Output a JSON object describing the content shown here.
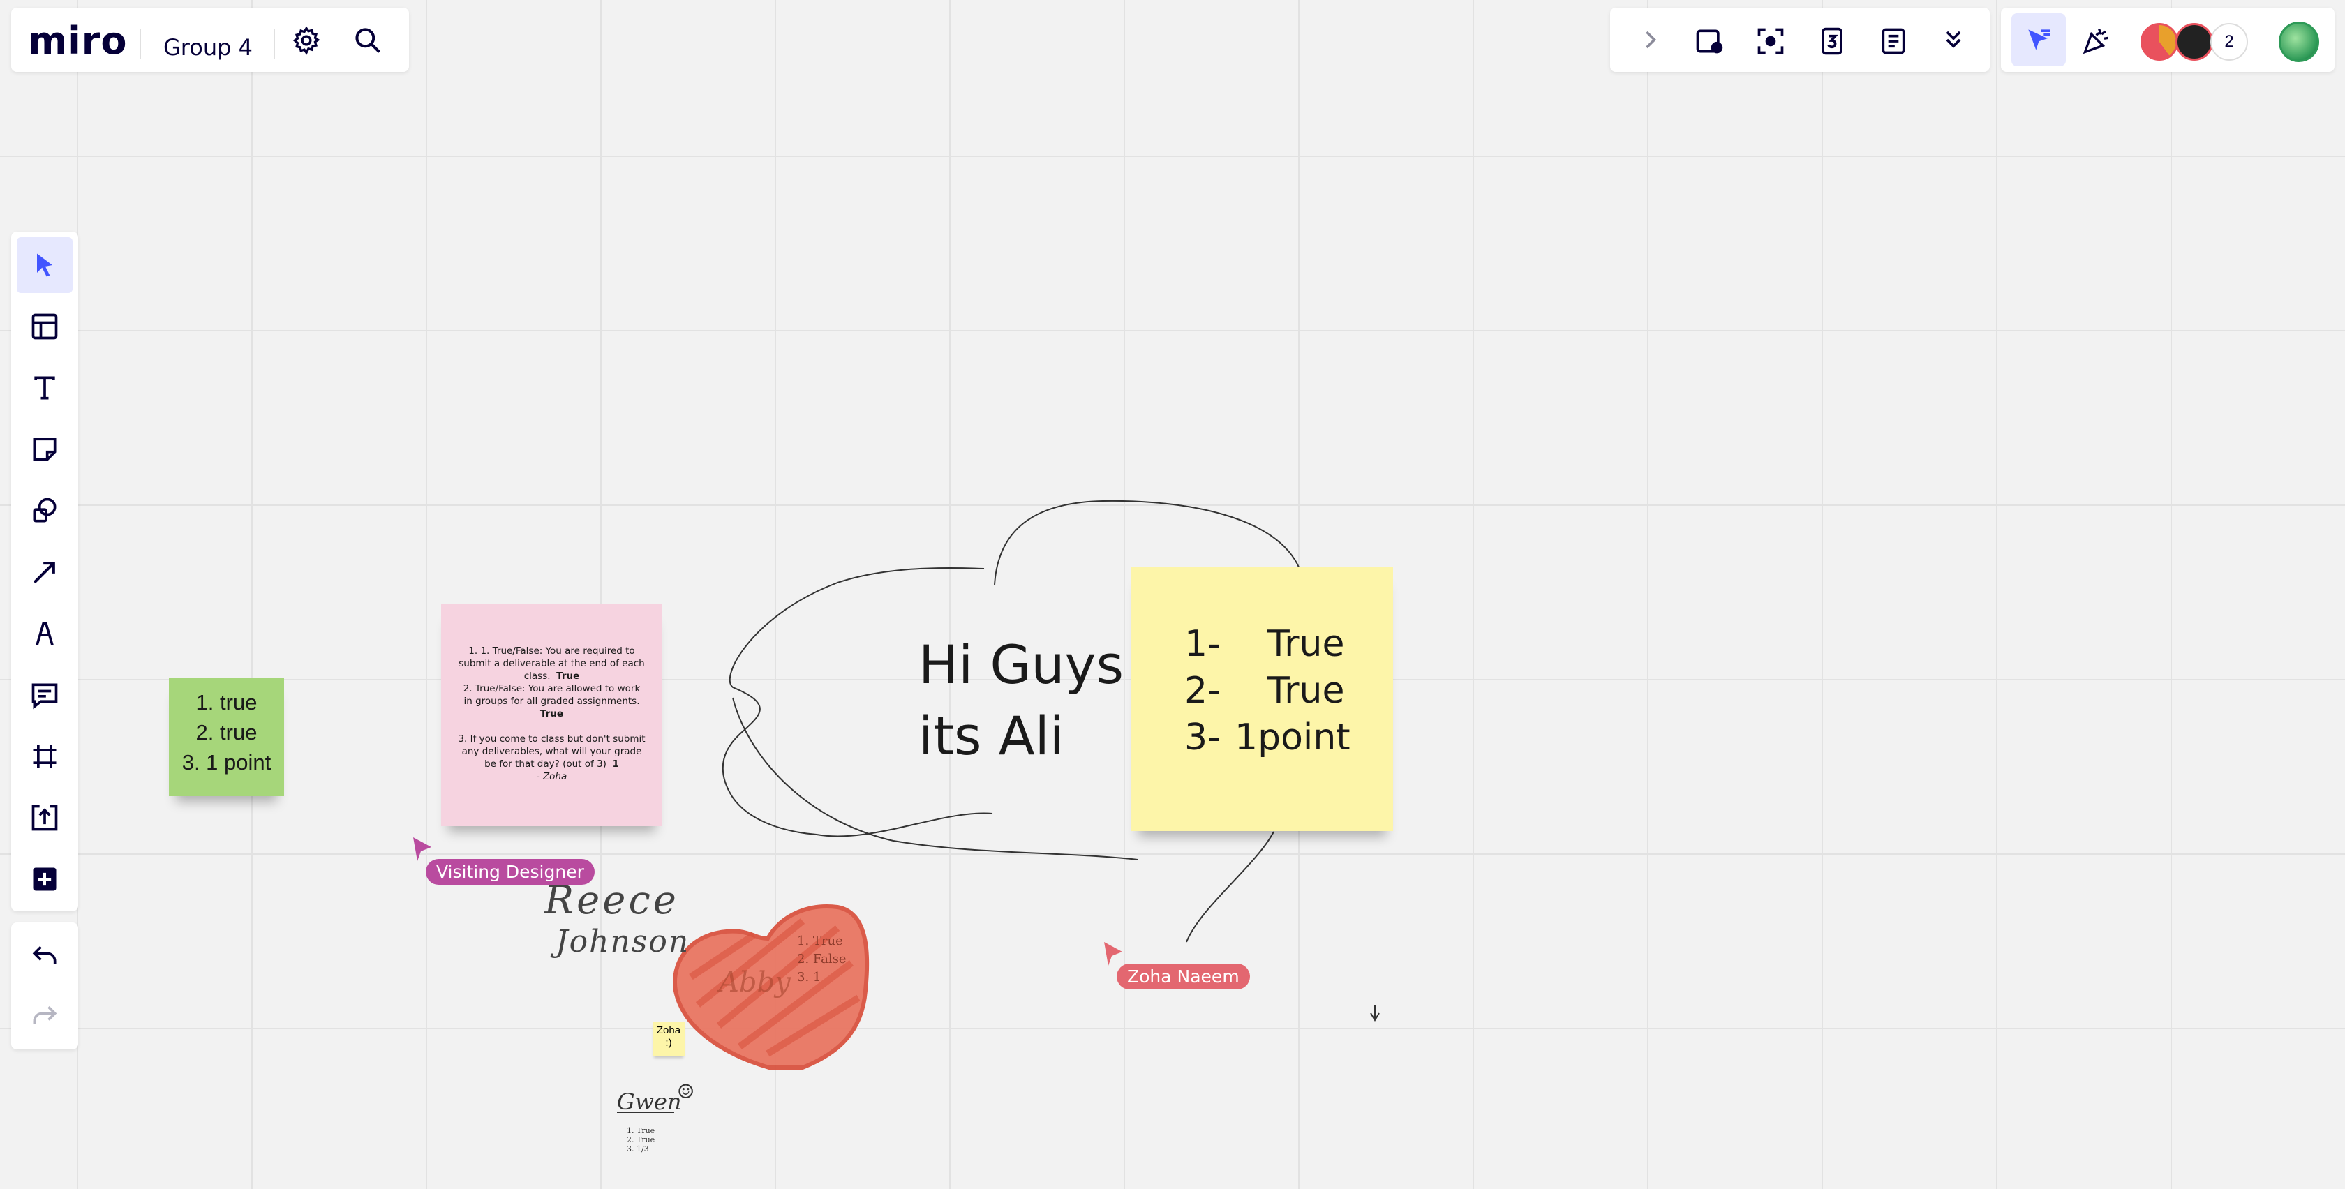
{
  "header": {
    "logo": "miro",
    "board_name": "Group 4"
  },
  "top_tools": {
    "icons": [
      "chevron-right-icon",
      "present-icon",
      "focus-icon",
      "timer-icon",
      "notes-icon",
      "more-icon"
    ]
  },
  "collaborators": {
    "extra_count": "2",
    "avatar_colors": [
      "#e8a02c",
      "#e9515d",
      "#2e9a57"
    ]
  },
  "left_toolbar": {
    "tools": [
      "select",
      "templates",
      "text",
      "sticky-note",
      "shapes",
      "line",
      "pen",
      "comment",
      "frame",
      "upload",
      "more-apps"
    ],
    "active": "select"
  },
  "canvas": {
    "sticky_green": {
      "lines": [
        "1. true",
        "2. true",
        "3. 1 point"
      ],
      "color": "#a6d67a"
    },
    "sticky_pink": {
      "q1": "1. 1. True/False: You are required to submit a deliverable at the end of each class.",
      "q1_answer": "True",
      "q2": "2. True/False: You are allowed to work in groups for all graded assignments.",
      "q2_answer": "True",
      "q3": "3. If you come to class but don't submit any deliverables, what will your grade be for that day? (out of 3)",
      "q3_answer": "1",
      "signature": "- Zoha",
      "color": "#f6d3e0"
    },
    "hi_text": {
      "line1": "Hi Guys",
      "line2": "its Ali"
    },
    "sticky_yellow": {
      "rows": [
        {
          "num": "1-",
          "value": "True"
        },
        {
          "num": "2-",
          "value": "True"
        },
        {
          "num": "3-",
          "value": "1point"
        }
      ],
      "color": "#fdf5a9"
    },
    "sticky_mini": {
      "line1": "Zoha",
      "line2": ":)"
    },
    "handwriting_reece": {
      "line1": "Reece",
      "line2": "Johnson"
    },
    "heart_text": {
      "name": "Abby",
      "lines": [
        "1. True",
        "2. False",
        "3. 1"
      ]
    },
    "handwriting_gwen": {
      "name": "Gwen",
      "smile": "☺",
      "lines": [
        "1. True",
        "2. True",
        "3. 1/3"
      ]
    },
    "cursors": [
      {
        "name": "Visiting Designer",
        "color": "#b94b9f"
      },
      {
        "name": "Zoha Naeem",
        "color": "#e36770"
      }
    ]
  }
}
